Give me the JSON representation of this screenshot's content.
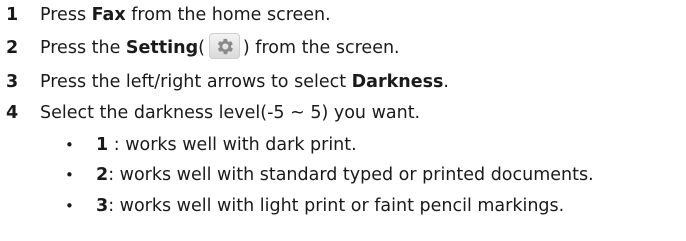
{
  "steps": [
    {
      "num": "1",
      "pre": "Press ",
      "bold": "Fax",
      "post": " from the home screen."
    },
    {
      "num": "2",
      "pre": "Press the ",
      "bold": "Setting",
      "paren_open": "(",
      "icon": "gear-icon",
      "paren_close": ") from the screen."
    },
    {
      "num": "3",
      "pre": "Press the left/right arrows to select ",
      "bold": "Darkness",
      "post": "."
    },
    {
      "num": "4",
      "text": "Select the darkness level(-5 ~ 5) you want."
    }
  ],
  "bullets": [
    {
      "symbol": "•",
      "bold": "1",
      "post": " : works well with dark print."
    },
    {
      "symbol": "•",
      "bold": "2",
      "post": ": works well with standard typed or printed documents."
    },
    {
      "symbol": "•",
      "bold": "3",
      "post": ": works well with light print or faint pencil markings."
    }
  ],
  "colors": {
    "text": "#1a1a1a",
    "icon_bg": "#e3e3e3",
    "icon_fg": "#8a8a8a"
  }
}
